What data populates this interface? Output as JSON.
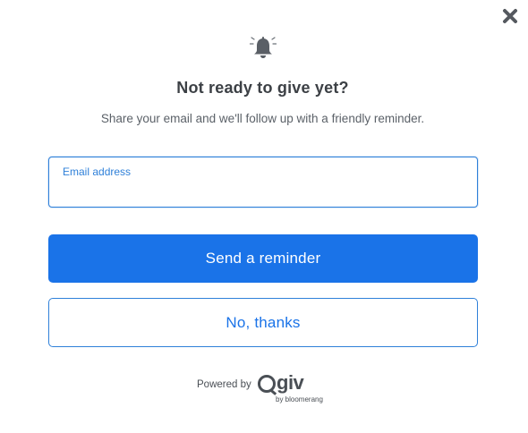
{
  "modal": {
    "title": "Not ready to give yet?",
    "subtitle": "Share your email and we'll follow up with a friendly reminder.",
    "close_icon": "close-icon",
    "bell_icon": "bell-icon"
  },
  "email": {
    "label": "Email address",
    "value": "",
    "placeholder": ""
  },
  "actions": {
    "primary_label": "Send a reminder",
    "secondary_label": "No, thanks"
  },
  "footer": {
    "powered_by": "Powered by",
    "brand": "giv",
    "brand_sub": "by bloomerang"
  },
  "colors": {
    "accent": "#1a73e8",
    "title": "#3c4045",
    "bell": "#5a5f66"
  }
}
